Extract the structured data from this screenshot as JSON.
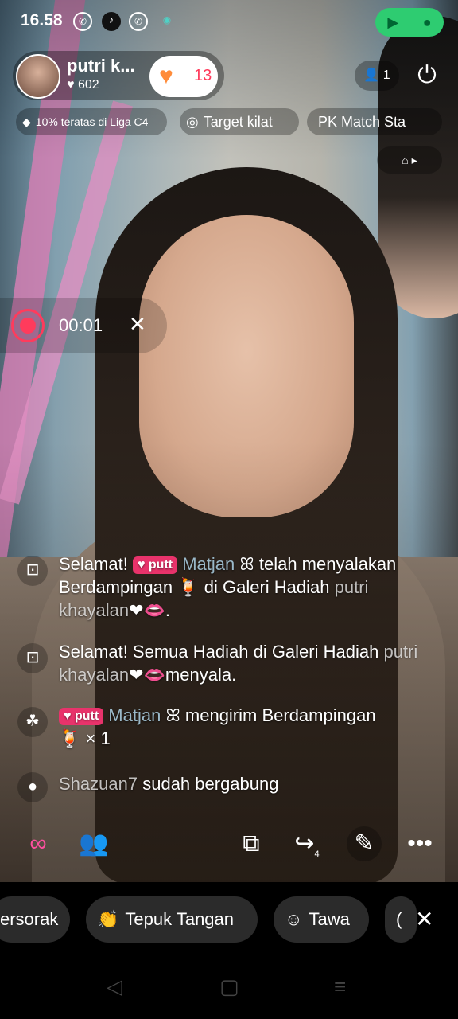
{
  "status_bar": {
    "time": "16.58"
  },
  "host": {
    "name": "putri k...",
    "likes": "602",
    "gift_count": "13"
  },
  "viewers": {
    "count": "1"
  },
  "pills": {
    "league": "10% teratas di Liga C4",
    "target": "Target kilat",
    "pk": "PK Match Sta"
  },
  "recording": {
    "time": "00:01"
  },
  "chat": [
    {
      "prefix": "Selamat!",
      "badge": "putt",
      "user": "Matjan",
      "text": "telah menyalakan Berdampingan",
      "suffix": "di Galeri Hadiah",
      "owner": "putri khayalan",
      "end": "."
    },
    {
      "text": "Selamat! Semua Hadiah di Galeri Hadiah",
      "owner": "putri khayalan",
      "end": "menyala."
    },
    {
      "badge": "putt",
      "user": "Matjan",
      "text": "mengirim Berdampingan",
      "count": "× 1"
    },
    {
      "user": "Shazuan7",
      "text": "sudah bergabung"
    }
  ],
  "action_bar": {
    "share_count": "4"
  },
  "reactions": {
    "cheer": "ersorak",
    "clap": "Tepuk Tangan",
    "laugh": "Tawa"
  },
  "colors": {
    "accent": "#ff3b5c",
    "record_green": "#2ecc71"
  }
}
